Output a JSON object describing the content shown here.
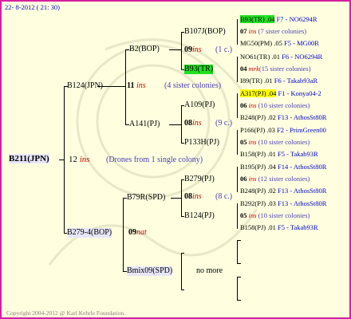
{
  "header": {
    "date": "22- 8-2012 ( 21: 30)"
  },
  "root": {
    "name": "B211(JPN)",
    "year": "12",
    "ins": "ins",
    "drones": "(Drones from 1 single colony)"
  },
  "sire": {
    "name": "B124(JPN)",
    "year": "11",
    "ins": "ins",
    "sisters": "(4 sister colonies)"
  },
  "dam": {
    "name": "B279-4(BOP)",
    "year": "09",
    "ins": "nat"
  },
  "g2": [
    {
      "name": "B2(BOP)",
      "year": "09",
      "ins": "ins",
      "sisters": "(1 c.)"
    },
    {
      "name": "A141(PJ)",
      "year": "08",
      "ins": "ins",
      "sisters": "(9 c.)"
    },
    {
      "name": "B79R(SPD)",
      "year": "08",
      "ins": "ins",
      "sisters": "(8 c.)"
    },
    {
      "name": "Bmix09(SPD)",
      "note": "no more"
    }
  ],
  "g3": [
    "B107J(BOP)",
    "B93(TR)",
    "A109(PJ)",
    "P133H(PJ)",
    "B279(PJ)",
    "B124(PJ)"
  ],
  "g4": [
    {
      "name": "B93(TR) .04",
      "info": "F7 - NO6294R"
    },
    {
      "name": "07",
      "ins": "ins",
      "info": "(7 sister colonies)"
    },
    {
      "name": "MG50(PM) .05",
      "info": "F5 - MG00R"
    },
    {
      "name": "NO61(TR) .01",
      "info": "F6 - NO6294R"
    },
    {
      "name": "04",
      "ins": "mrk",
      "info": "(15 sister colonies)"
    },
    {
      "name": "I89(TR) .01",
      "info": "F6 - Takab93aR"
    },
    {
      "name": "A317(PJ) .04",
      "info": "F1 - Konya04-2"
    },
    {
      "name": "06",
      "ins": "ins",
      "info": "(10 sister colonies)"
    },
    {
      "name": "B248(PJ) .02",
      "info": "F13 - AthosSt80R"
    },
    {
      "name": "P166(PJ) .03",
      "info": "F2 - PrimGreen00"
    },
    {
      "name": "05",
      "ins": "ins",
      "info": "(10 sister colonies)"
    },
    {
      "name": "B158(PJ) .01",
      "info": "F5 - Takab93R"
    },
    {
      "name": "B195(PJ) .04",
      "info": "F14 - AthosSt80R"
    },
    {
      "name": "06",
      "ins": "ins",
      "info": "(12 sister colonies)"
    },
    {
      "name": "B248(PJ) .02",
      "info": "F13 - AthosSt80R"
    },
    {
      "name": "B292(PJ) .03",
      "info": "F13 - AthosSt80R"
    },
    {
      "name": "05",
      "ins": "ins",
      "info": "(10 sister colonies)"
    },
    {
      "name": "B158(PJ) .01",
      "info": "F5 - Takab93R"
    }
  ],
  "footer": {
    "copyright": "Copyright 2004-2012 @ Karl Kehrle Foundation."
  },
  "colors": {
    "frame": "#d61fa0",
    "background": "#ffffe0",
    "highlight_green": "#22e022",
    "highlight_yellow": "#ffff00",
    "link_blue": "#0000c8",
    "ins_red": "#d00000"
  }
}
